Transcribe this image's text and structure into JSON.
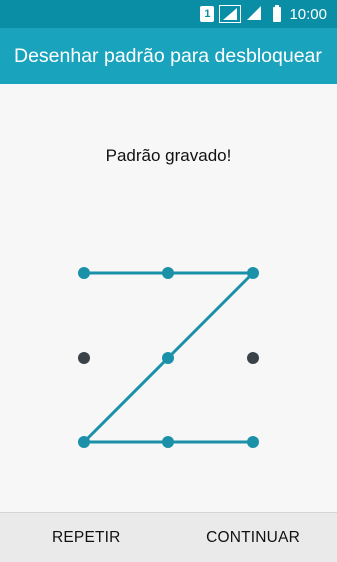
{
  "status_bar": {
    "sim_label": "1",
    "time": "10:00",
    "icons": [
      "sim-1-icon",
      "signal-icon",
      "signal-icon",
      "battery-icon"
    ]
  },
  "app_bar": {
    "title": "Desenhar padrão para desbloquear"
  },
  "pattern": {
    "message": "Padrão gravado!",
    "active_color": "#1a91a8",
    "inactive_color": "#3a4249",
    "dots": [
      {
        "row": 1,
        "col": 1,
        "selected": true
      },
      {
        "row": 1,
        "col": 2,
        "selected": true
      },
      {
        "row": 1,
        "col": 3,
        "selected": true
      },
      {
        "row": 2,
        "col": 1,
        "selected": false
      },
      {
        "row": 2,
        "col": 2,
        "selected": true
      },
      {
        "row": 2,
        "col": 3,
        "selected": false
      },
      {
        "row": 3,
        "col": 1,
        "selected": true
      },
      {
        "row": 3,
        "col": 2,
        "selected": true
      },
      {
        "row": 3,
        "col": 3,
        "selected": true
      }
    ],
    "sequence": [
      [
        1,
        1
      ],
      [
        1,
        2
      ],
      [
        1,
        3
      ],
      [
        2,
        2
      ],
      [
        3,
        1
      ],
      [
        3,
        2
      ],
      [
        3,
        3
      ]
    ]
  },
  "actions": {
    "repeat_label": "REPETIR",
    "continue_label": "CONTINUAR"
  }
}
